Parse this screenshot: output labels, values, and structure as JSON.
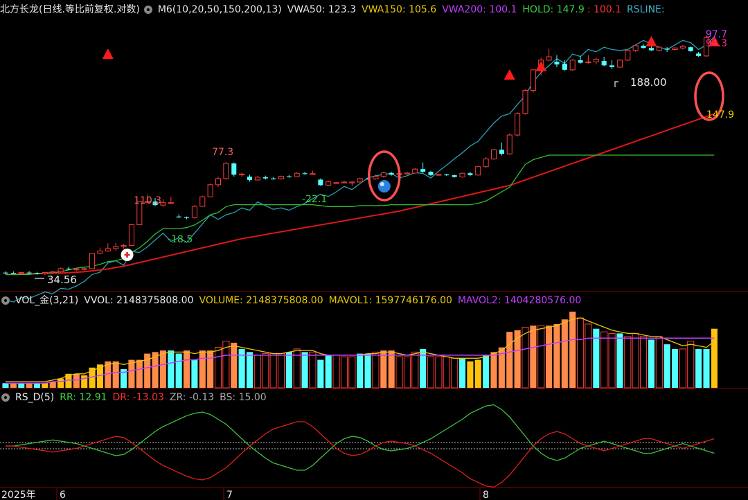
{
  "header_main": {
    "title": "北方长龙(日线.等比前复权.对数)",
    "ma": "M6(10,20,50,150,200,13)",
    "vwa50": "VWA50: 123.3",
    "vwa150": "VWA150: 105.6",
    "vwa200": "VWA200: 100.1",
    "hold": "HOLD: 147.9",
    "hold2": ": 100.1",
    "rsline": "RSLINE:",
    "colors": {
      "vwa50": "#e8e8e8",
      "vwa150": "#e8c800",
      "vwa200": "#c040ff",
      "hold": "#40d040",
      "hold2": "#ff3030",
      "rsline": "#3cb4c8"
    }
  },
  "header_vol": {
    "name": "VOL_金(3,21)",
    "vvol": "VVOL: 2148375808.00",
    "volume": "VOLUME: 2148375808.00",
    "mavol1": "MAVOL1: 1597746176.00",
    "mavol2": "MAVOL2: 1404280576.00"
  },
  "header_rs": {
    "name": "RS_D(5)",
    "rr": "RR: 12.91",
    "dr": "DR: -13.03",
    "zr": "ZR: -0.13",
    "bs": "BS: 15.00"
  },
  "x_axis": {
    "year": "2025年",
    "months": [
      "6",
      "7",
      "8"
    ]
  },
  "chart_data": {
    "type": "candlestick",
    "candles": [
      [
        34.6,
        34.9,
        34.2,
        34.5
      ],
      [
        34.5,
        34.9,
        34.3,
        34.4
      ],
      [
        34.4,
        34.8,
        34.1,
        34.6
      ],
      [
        34.6,
        35.0,
        34.3,
        34.5
      ],
      [
        34.5,
        34.8,
        34.0,
        34.3
      ],
      [
        34.3,
        34.7,
        34.0,
        34.6
      ],
      [
        34.6,
        35.1,
        34.4,
        34.8
      ],
      [
        34.8,
        35.9,
        34.6,
        35.6
      ],
      [
        35.6,
        36.1,
        35.2,
        35.4
      ],
      [
        35.4,
        35.8,
        35.0,
        35.5
      ],
      [
        35.5,
        35.9,
        35.1,
        35.6
      ],
      [
        35.6,
        39.8,
        35.5,
        39.8
      ],
      [
        39.8,
        41.5,
        39.5,
        40.5
      ],
      [
        40.5,
        42.8,
        40.2,
        41.2
      ],
      [
        41.2,
        43.0,
        40.6,
        41.8
      ],
      [
        41.8,
        42.6,
        41.2,
        42.1
      ],
      [
        42.1,
        49.0,
        42.0,
        49.0
      ],
      [
        49.0,
        58.0,
        49.0,
        58.0
      ],
      [
        58.0,
        61.0,
        57.5,
        58.0
      ],
      [
        58.0,
        59.5,
        56.2,
        56.5
      ],
      [
        56.5,
        59.0,
        55.8,
        57.5
      ],
      [
        57.5,
        60.0,
        57.0,
        57.6
      ],
      [
        52.0,
        52.8,
        51.5,
        51.8
      ],
      [
        51.8,
        52.0,
        51.0,
        51.6
      ],
      [
        51.6,
        56.5,
        51.2,
        56.0
      ],
      [
        56.0,
        60.5,
        55.8,
        60.0
      ],
      [
        60.0,
        66.0,
        59.8,
        65.5
      ],
      [
        65.5,
        69.5,
        64.5,
        68.5
      ],
      [
        68.5,
        77.3,
        68.0,
        76.5
      ],
      [
        76.5,
        77.0,
        69.5,
        70.5
      ],
      [
        70.5,
        71.5,
        69.5,
        70.8
      ],
      [
        69.5,
        70.5,
        67.0,
        67.8
      ],
      [
        67.8,
        69.8,
        67.5,
        69.2
      ],
      [
        69.2,
        70.0,
        68.0,
        68.6
      ],
      [
        68.6,
        69.3,
        68.0,
        68.4
      ],
      [
        68.4,
        70.0,
        68.0,
        69.6
      ],
      [
        69.6,
        70.3,
        69.0,
        69.5
      ],
      [
        69.5,
        71.8,
        69.3,
        71.2
      ],
      [
        71.2,
        72.0,
        70.5,
        71.0
      ],
      [
        71.0,
        72.5,
        70.8,
        71.0
      ],
      [
        68.0,
        68.6,
        65.0,
        65.3
      ],
      [
        65.3,
        67.5,
        65.0,
        67.0
      ],
      [
        66.0,
        66.8,
        65.8,
        66.5
      ],
      [
        66.5,
        67.5,
        66.3,
        66.8
      ],
      [
        66.8,
        67.3,
        65.0,
        66.8
      ],
      [
        66.8,
        68.9,
        66.5,
        68.5
      ],
      [
        68.5,
        69.0,
        68.0,
        68.4
      ],
      [
        68.4,
        70.5,
        68.0,
        69.6
      ],
      [
        69.6,
        72.0,
        69.0,
        71.4
      ],
      [
        71.4,
        72.0,
        70.0,
        70.5
      ],
      [
        70.5,
        71.5,
        70.0,
        71.0
      ],
      [
        71.0,
        72.0,
        70.5,
        71.3
      ],
      [
        71.3,
        74.0,
        71.0,
        73.4
      ],
      [
        73.4,
        77.0,
        71.3,
        72.0
      ],
      [
        72.0,
        72.5,
        69.8,
        70.3
      ],
      [
        70.3,
        71.0,
        70.0,
        70.6
      ],
      [
        70.6,
        71.0,
        69.8,
        70.2
      ],
      [
        70.2,
        70.5,
        69.0,
        69.3
      ],
      [
        69.3,
        71.5,
        69.0,
        71.2
      ],
      [
        71.2,
        72.0,
        69.7,
        70.3
      ],
      [
        70.3,
        75.0,
        70.0,
        74.7
      ],
      [
        74.7,
        80.0,
        74.0,
        79.0
      ],
      [
        79.0,
        85.0,
        78.5,
        84.5
      ],
      [
        84.5,
        89.0,
        81.0,
        82.0
      ],
      [
        82.0,
        95.0,
        81.5,
        94.0
      ],
      [
        94.0,
        111.0,
        93.0,
        110.0
      ],
      [
        110.0,
        131.0,
        109.0,
        130.0
      ],
      [
        130.0,
        152.0,
        128.0,
        151.0
      ],
      [
        151.0,
        165.0,
        145.0,
        162.0
      ],
      [
        162.0,
        176.0,
        161.0,
        166.0
      ],
      [
        160.0,
        168.0,
        154.0,
        157.0
      ],
      [
        158.0,
        162.0,
        150.0,
        151.0
      ],
      [
        151.0,
        163.0,
        150.0,
        162.0
      ],
      [
        162.0,
        167.0,
        158.0,
        159.0
      ],
      [
        159.0,
        168.0,
        158.0,
        160.0
      ],
      [
        160.0,
        165.0,
        157.0,
        163.0
      ],
      [
        161.0,
        166.0,
        155.0,
        156.0
      ],
      [
        156.0,
        162.0,
        152.0,
        154.0
      ],
      [
        154.0,
        163.0,
        153.0,
        162.0
      ],
      [
        162.0,
        175.0,
        161.0,
        174.0
      ],
      [
        174.0,
        181.0,
        172.0,
        180.0
      ],
      [
        180.0,
        182.0,
        176.0,
        177.0
      ],
      [
        177.0,
        179.0,
        173.0,
        174.0
      ],
      [
        174.0,
        179.0,
        173.0,
        178.0
      ],
      [
        176.0,
        178.0,
        172.0,
        175.0
      ],
      [
        175.0,
        178.0,
        174.0,
        177.0
      ],
      [
        177.0,
        181.0,
        175.0,
        179.0
      ],
      [
        178.0,
        179.0,
        172.0,
        173.0
      ],
      [
        170.0,
        172.0,
        166.0,
        167.0
      ],
      [
        167.0,
        194.0,
        166.0,
        191.0
      ]
    ],
    "bar_values": [
      3,
      3,
      3,
      3,
      3,
      3,
      4,
      6,
      9,
      9,
      8,
      13,
      15,
      17,
      17,
      12,
      18,
      18,
      22,
      23,
      24,
      24,
      22,
      24,
      18,
      24,
      24,
      26,
      30,
      29,
      25,
      23,
      21,
      22,
      22,
      22,
      23,
      25,
      23,
      23,
      18,
      21,
      21,
      20,
      20,
      22,
      22,
      23,
      24,
      24,
      20,
      20,
      23,
      25,
      20,
      20,
      20,
      19,
      19,
      17,
      18,
      21,
      23,
      26,
      36,
      37,
      39,
      40,
      40,
      40,
      41,
      44,
      49,
      45,
      41,
      38,
      36,
      35,
      35,
      33,
      35,
      33,
      31,
      33,
      28,
      25,
      25,
      30,
      25,
      25,
      38
    ],
    "bar_colors": [
      "c",
      "o",
      "c",
      "o",
      "c",
      "y",
      "o",
      "y",
      "y",
      "o",
      "y",
      "y",
      "y",
      "o",
      "o",
      "c",
      "o",
      "o",
      "o",
      "o",
      "o",
      "c",
      "c",
      "o",
      "c",
      "o",
      "o",
      "r",
      "r",
      "o",
      "c",
      "c",
      "r",
      "r",
      "r",
      "r",
      "c",
      "r",
      "c",
      "r",
      "c",
      "c",
      "r",
      "r",
      "r",
      "c",
      "c",
      "r",
      "o",
      "o",
      "r",
      "r",
      "r",
      "c",
      "r",
      "r",
      "r",
      "r",
      "c",
      "y",
      "y",
      "c",
      "o",
      "o",
      "o",
      "o",
      "r",
      "o",
      "r",
      "o",
      "o",
      "o",
      "o",
      "r",
      "r",
      "c",
      "r",
      "r",
      "c",
      "r",
      "r",
      "r",
      "c",
      "r",
      "c",
      "c",
      "r",
      "r",
      "c",
      "c",
      "y"
    ],
    "labels": {
      "max_marker": "188.00",
      "low_marker": "34.56",
      "upper1": "97.7",
      "upper2": "94.3",
      "right_tag": "147.9",
      "t1": "110.3",
      "t2": "-18.5",
      "t3": "77.3",
      "t4": "-22.1"
    },
    "upper_line": [
      155,
      150,
      160,
      158,
      165,
      172,
      168,
      180,
      178,
      185,
      195,
      210,
      215,
      235,
      240,
      230,
      260,
      258,
      270,
      285,
      300,
      282,
      290,
      280,
      300,
      320,
      340,
      330,
      340,
      345,
      355,
      350,
      368,
      360,
      352,
      355,
      350,
      358,
      365,
      375,
      385,
      380,
      390,
      402,
      395,
      408,
      420,
      425,
      428,
      430,
      420,
      425,
      432,
      430,
      420,
      435,
      448,
      462,
      475,
      490,
      500,
      520,
      540,
      555,
      560,
      580,
      600,
      630,
      650,
      665,
      680,
      670,
      690,
      685,
      700,
      695,
      705,
      700,
      698,
      700,
      710,
      720,
      712,
      705,
      700,
      710,
      720,
      715,
      700,
      710,
      728
    ],
    "green_line": [
      210,
      210,
      210,
      210,
      212,
      213,
      214,
      216,
      220,
      224,
      226,
      228,
      232,
      238,
      240,
      245,
      258,
      268,
      282,
      298,
      310,
      310,
      310,
      312,
      318,
      328,
      340,
      345,
      358,
      362,
      362,
      362,
      362,
      362,
      362,
      362,
      362,
      362,
      362,
      362,
      360,
      358,
      358,
      358,
      358,
      360,
      360,
      360,
      360,
      362,
      362,
      362,
      362,
      362,
      362,
      362,
      362,
      362,
      362,
      362,
      365,
      370,
      380,
      390,
      400,
      425,
      450,
      460,
      465,
      470,
      470,
      470,
      470,
      470,
      470,
      470,
      470,
      470,
      470,
      470,
      470,
      470,
      470,
      470,
      470,
      470,
      470,
      470,
      470,
      470,
      470
    ],
    "red_line": [
      210,
      210,
      211,
      211,
      212,
      212,
      213,
      213,
      214,
      215,
      216,
      218,
      220,
      222,
      225,
      228,
      232,
      236,
      240,
      244,
      248,
      252,
      256,
      260,
      264,
      268,
      272,
      276,
      280,
      284,
      288,
      291,
      294,
      297,
      300,
      303,
      306,
      309,
      312,
      315,
      318,
      321,
      324,
      327,
      330,
      333,
      336,
      339,
      342,
      345,
      348,
      352,
      356,
      360,
      364,
      368,
      372,
      376,
      380,
      384,
      388,
      392,
      396,
      400,
      404,
      410,
      416,
      422,
      428,
      434,
      440,
      446,
      452,
      458,
      464,
      470,
      476,
      482,
      488,
      494,
      500,
      506,
      512,
      518,
      524,
      530,
      536,
      542,
      548,
      554,
      560
    ],
    "mavol1": [
      4,
      4,
      4,
      4,
      4,
      4,
      5,
      6,
      8,
      9,
      9,
      11,
      13,
      15,
      16,
      15,
      16,
      17,
      18,
      20,
      22,
      23,
      23,
      23,
      22,
      23,
      23,
      24,
      26,
      27,
      26,
      25,
      24,
      23,
      22,
      22,
      23,
      24,
      24,
      24,
      22,
      21,
      21,
      21,
      21,
      21,
      22,
      22,
      23,
      23,
      22,
      21,
      22,
      23,
      22,
      21,
      20,
      19,
      19,
      19,
      19,
      20,
      22,
      24,
      28,
      32,
      35,
      37,
      38,
      39,
      40,
      42,
      44,
      45,
      43,
      41,
      39,
      37,
      36,
      35,
      35,
      34,
      33,
      33,
      31,
      29,
      27,
      28,
      27,
      26,
      30
    ],
    "mavol2": [
      3,
      3,
      3,
      3,
      3,
      3,
      4,
      4,
      5,
      5,
      6,
      7,
      8,
      9,
      10,
      10,
      11,
      12,
      13,
      14,
      15,
      16,
      17,
      18,
      18,
      19,
      19,
      20,
      21,
      21,
      21,
      21,
      21,
      21,
      21,
      21,
      21,
      21,
      21,
      21,
      21,
      21,
      21,
      21,
      21,
      21,
      21,
      21,
      21,
      21,
      21,
      21,
      21,
      21,
      21,
      21,
      21,
      21,
      21,
      21,
      21,
      21,
      21,
      22,
      23,
      24,
      25,
      26,
      27,
      28,
      29,
      30,
      31,
      31,
      32,
      32,
      32,
      32,
      32,
      32,
      32,
      32,
      32,
      32,
      32,
      32,
      32,
      32,
      32,
      32,
      32
    ],
    "rs_green": [
      0,
      0,
      1,
      2,
      3,
      4,
      5,
      4,
      3,
      2,
      0,
      -2,
      -4,
      -6,
      -8,
      -7,
      -3,
      2,
      7,
      12,
      16,
      19,
      22,
      25,
      27,
      28,
      26,
      22,
      18,
      12,
      6,
      0,
      -5,
      -10,
      -14,
      -16,
      -18,
      -20,
      -20,
      -16,
      -10,
      -4,
      2,
      6,
      8,
      7,
      4,
      0,
      -3,
      -4,
      -3,
      -2,
      0,
      3,
      6,
      10,
      14,
      18,
      22,
      27,
      30,
      33,
      34,
      30,
      24,
      16,
      8,
      0,
      -6,
      -10,
      -12,
      -10,
      -6,
      -2,
      0,
      2,
      4,
      2,
      0,
      -2,
      -4,
      -6,
      -6,
      -4,
      -2,
      0,
      2,
      0,
      -2,
      -4,
      -6
    ],
    "rs_red": [
      0,
      0,
      -1,
      -2,
      -3,
      -4,
      -5,
      -4,
      -3,
      -2,
      0,
      2,
      4,
      6,
      8,
      7,
      3,
      -2,
      -7,
      -12,
      -16,
      -19,
      -22,
      -25,
      -27,
      -28,
      -26,
      -22,
      -18,
      -12,
      -6,
      0,
      5,
      10,
      14,
      16,
      18,
      20,
      20,
      16,
      10,
      4,
      -2,
      -6,
      -8,
      -7,
      -4,
      0,
      3,
      4,
      3,
      2,
      0,
      -3,
      -6,
      -10,
      -14,
      -18,
      -22,
      -27,
      -30,
      -33,
      -34,
      -30,
      -24,
      -16,
      -8,
      0,
      6,
      10,
      12,
      10,
      6,
      2,
      0,
      -2,
      -4,
      -2,
      0,
      2,
      4,
      6,
      6,
      4,
      2,
      0,
      -2,
      0,
      2,
      4,
      6
    ]
  }
}
